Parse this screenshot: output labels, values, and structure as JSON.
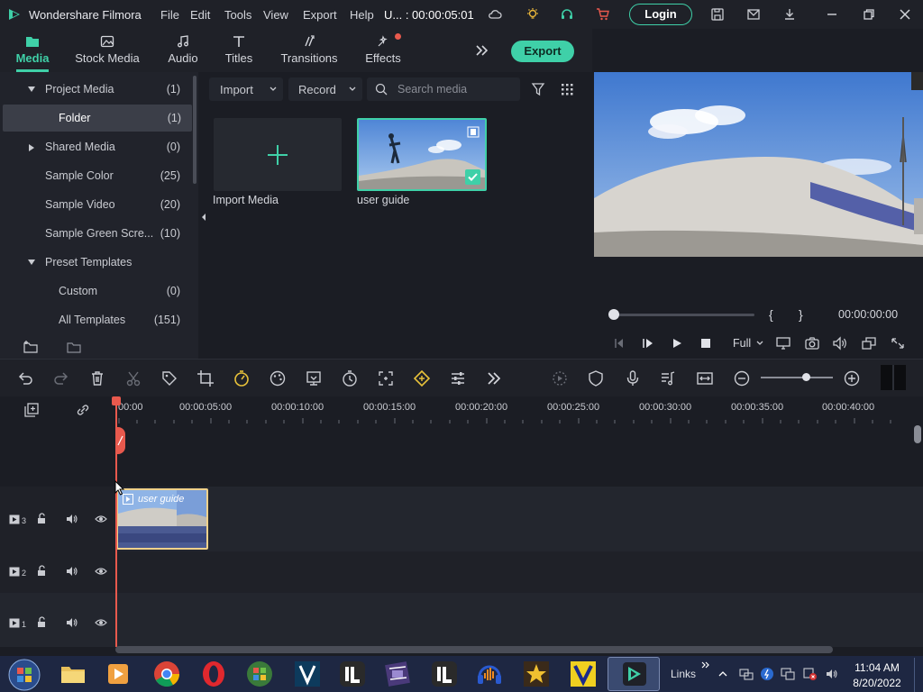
{
  "app": {
    "title": "Wondershare Filmora",
    "project_title": "U... : 00:00:05:01"
  },
  "menu": [
    "File",
    "Edit",
    "Tools",
    "View",
    "Export",
    "Help"
  ],
  "login_label": "Login",
  "export_label": "Export",
  "tabs": [
    {
      "label": "Media",
      "icon": "media-icon",
      "active": true
    },
    {
      "label": "Stock Media",
      "icon": "stock-media-icon"
    },
    {
      "label": "Audio",
      "icon": "music-note-icon"
    },
    {
      "label": "Titles",
      "icon": "text-t-icon"
    },
    {
      "label": "Transitions",
      "icon": "transitions-icon"
    },
    {
      "label": "Effects",
      "icon": "effects-icon",
      "badge": true
    }
  ],
  "sidebar": [
    {
      "label": "Project Media",
      "count": "(1)",
      "caret": "down"
    },
    {
      "label": "Folder",
      "count": "(1)",
      "selected": true
    },
    {
      "label": "Shared Media",
      "count": "(0)",
      "caret": "right"
    },
    {
      "label": "Sample Color",
      "count": "(25)"
    },
    {
      "label": "Sample Video",
      "count": "(20)"
    },
    {
      "label": "Sample Green Scre...",
      "count": "(10)"
    },
    {
      "label": "Preset Templates",
      "count": "",
      "caret": "down"
    },
    {
      "label": "Custom",
      "count": "(0)"
    },
    {
      "label": "All Templates",
      "count": "(151)"
    }
  ],
  "media_toolbar": {
    "import": "Import",
    "record": "Record",
    "search_placeholder": "Search media"
  },
  "media_items": [
    {
      "label": "Import Media"
    },
    {
      "label": "user guide"
    }
  ],
  "preview": {
    "timecode": "00:00:00:00",
    "quality": "Full",
    "brackets": [
      "{",
      "}"
    ]
  },
  "ruler": [
    "00:00",
    "00:00:05:00",
    "00:00:10:00",
    "00:00:15:00",
    "00:00:20:00",
    "00:00:25:00",
    "00:00:30:00",
    "00:00:35:00",
    "00:00:40:00"
  ],
  "tracks": [
    "3",
    "2",
    "1"
  ],
  "clip": {
    "label": "user guide"
  },
  "taskbar": {
    "links": "Links",
    "time": "11:04 AM",
    "date": "8/20/2022"
  },
  "colors": {
    "accent": "#3fd0a8",
    "playhead": "#e8594d",
    "clip_border": "#f0d18a"
  }
}
